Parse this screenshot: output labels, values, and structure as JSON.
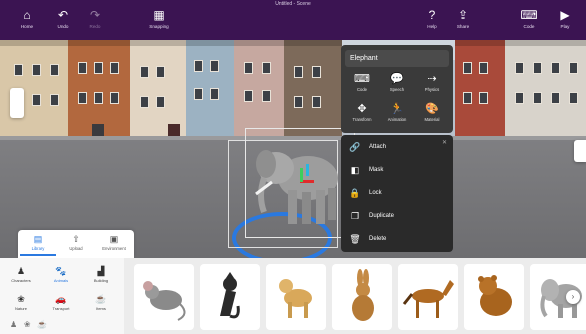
{
  "app": {
    "title": "Untitled - Scene"
  },
  "toolbar": {
    "left": [
      {
        "label": "Home",
        "icon": "home-icon",
        "glyph": "⌂"
      },
      {
        "label": "Undo",
        "icon": "undo-icon",
        "glyph": "↶"
      },
      {
        "label": "Redo",
        "icon": "redo-icon",
        "glyph": "↷"
      },
      {
        "label": "Snapping",
        "icon": "grid-icon",
        "glyph": "▦"
      }
    ],
    "right": [
      {
        "label": "Help",
        "icon": "help-icon",
        "glyph": "?"
      },
      {
        "label": "Share",
        "icon": "share-icon",
        "glyph": "⇪"
      },
      {
        "label": "Code",
        "icon": "code-icon",
        "glyph": "⌨"
      },
      {
        "label": "Play",
        "icon": "play-icon",
        "glyph": "▶"
      }
    ]
  },
  "context_menu": {
    "title": "Elephant",
    "grid": [
      {
        "label": "Code",
        "icon": "code-icon",
        "glyph": "⌨"
      },
      {
        "label": "Speech",
        "icon": "speech-icon",
        "glyph": "💬"
      },
      {
        "label": "Physics",
        "icon": "physics-icon",
        "glyph": "⇢"
      },
      {
        "label": "Transform",
        "icon": "transform-icon",
        "glyph": "✥"
      },
      {
        "label": "Animation",
        "icon": "animation-icon",
        "glyph": "🏃"
      },
      {
        "label": "Material",
        "icon": "material-icon",
        "glyph": "🎨"
      }
    ],
    "items": [
      {
        "label": "Attach",
        "icon": "attach-icon",
        "glyph": "🔗"
      },
      {
        "label": "Mask",
        "icon": "mask-icon",
        "glyph": "◧"
      },
      {
        "label": "Lock",
        "icon": "lock-icon",
        "glyph": "🔒"
      },
      {
        "label": "Duplicate",
        "icon": "duplicate-icon",
        "glyph": "❐"
      },
      {
        "label": "Delete",
        "icon": "trash-icon",
        "glyph": "🗑"
      }
    ]
  },
  "library_tabs": [
    {
      "label": "Library",
      "icon": "library-icon",
      "glyph": "▤",
      "active": true
    },
    {
      "label": "Upload",
      "icon": "upload-icon",
      "glyph": "⇧",
      "active": false
    },
    {
      "label": "Environment",
      "icon": "environment-icon",
      "glyph": "▣",
      "active": false
    }
  ],
  "categories": [
    {
      "label": "Characters",
      "icon": "person-icon",
      "glyph": "♟",
      "active": false
    },
    {
      "label": "Animals",
      "icon": "animal-icon",
      "glyph": "🐾",
      "active": true
    },
    {
      "label": "Building",
      "icon": "building-icon",
      "glyph": "▟",
      "active": false
    },
    {
      "label": "Nature",
      "icon": "nature-icon",
      "glyph": "❀",
      "active": false
    },
    {
      "label": "Transport",
      "icon": "transport-icon",
      "glyph": "🚗",
      "active": false
    },
    {
      "label": "Items",
      "icon": "items-icon",
      "glyph": "☕",
      "active": false
    }
  ],
  "assets": [
    {
      "name": "mouse",
      "color": "#8a8a8a"
    },
    {
      "name": "cat",
      "color": "#2b2b2b"
    },
    {
      "name": "dog",
      "color": "#d9a85a"
    },
    {
      "name": "rabbit",
      "color": "#c48a44"
    },
    {
      "name": "horse",
      "color": "#b06a22"
    },
    {
      "name": "bear",
      "color": "#a8641e"
    },
    {
      "name": "elephant",
      "color": "#a4a4a4"
    }
  ],
  "colors": {
    "toolbar_bg": "#3b1452",
    "accent": "#2a79e0",
    "menu_bg": "#2a2a2a"
  }
}
